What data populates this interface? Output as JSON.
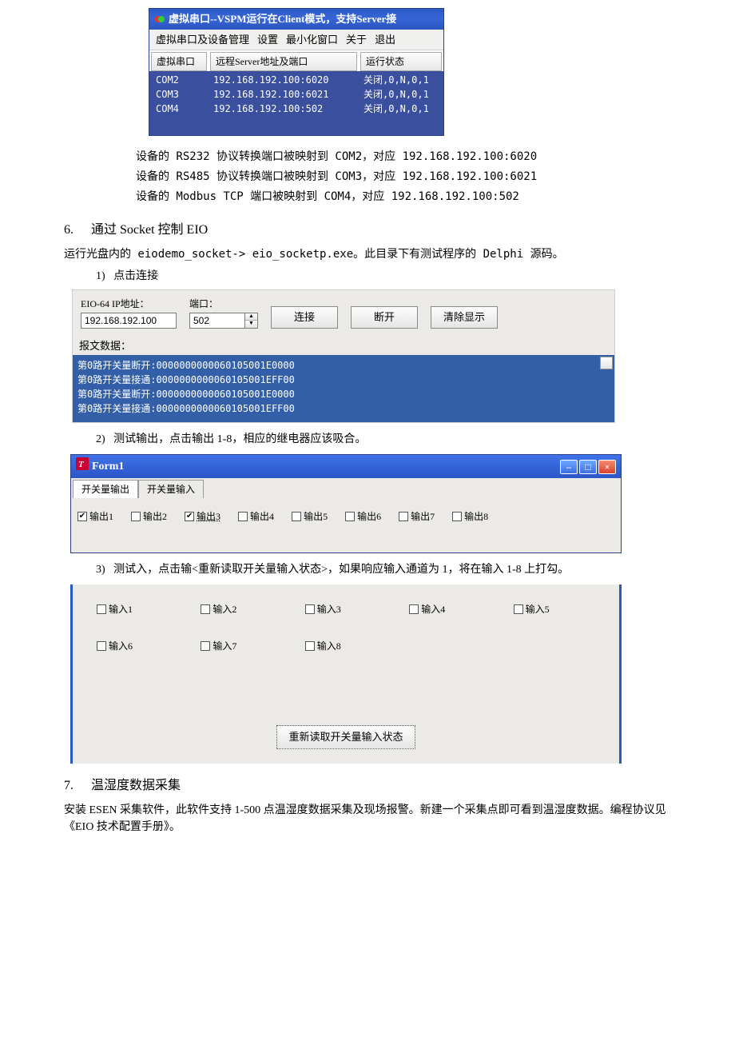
{
  "vspm": {
    "title": "虚拟串口--VSPM运行在Client模式，支持Server接",
    "menu": [
      "虚拟串口及设备管理",
      "设置",
      "最小化窗口",
      "关于",
      "退出"
    ],
    "headers": [
      "虚拟串口",
      "远程Server地址及端口",
      "运行状态"
    ],
    "rows": [
      {
        "port": "COM2",
        "addr": "192.168.192.100:6020",
        "state": "关闭,0,N,0,1"
      },
      {
        "port": "COM3",
        "addr": "192.168.192.100:6021",
        "state": "关闭,0,N,0,1"
      },
      {
        "port": "COM4",
        "addr": "192.168.192.100:502",
        "state": "关闭,0,N,0,1"
      }
    ]
  },
  "mapping": [
    "设备的 RS232 协议转换端口被映射到 COM2，对应 192.168.192.100:6020",
    "设备的 RS485 协议转换端口被映射到 COM3，对应 192.168.192.100:6021",
    "设备的 Modbus TCP 端口被映射到 COM4，对应 192.168.192.100:502"
  ],
  "section6": {
    "heading_num": "6.",
    "heading": "通过 Socket 控制 EIO",
    "intro": "运行光盘内的 eiodemo_socket-> eio_socketp.exe。此目录下有测试程序的 Delphi 源码。",
    "step1_num": "1)",
    "step1": "点击连接",
    "step2_num": "2)",
    "step2": "测试输出，点击输出 1-8，相应的继电器应该吸合。",
    "step3_num": "3)",
    "step3": "测试入，点击输<重新读取开关量输入状态>，如果响应输入通道为 1，将在输入 1-8 上打勾。"
  },
  "socket_tool": {
    "ip_label": "EIO-64 IP地址：",
    "ip_value": "192.168.192.100",
    "port_label": "端口：",
    "port_value": "502",
    "btn_connect": "连接",
    "btn_disconnect": "断开",
    "btn_clear": "清除显示",
    "log_label": "报文数据：",
    "log_lines": [
      "第0路开关量断开:0000000000060105001E0000",
      "第0路开关量接通:0000000000060105001EFF00",
      "第0路开关量断开:0000000000060105001E0000",
      "第0路开关量接通:0000000000060105001EFF00"
    ]
  },
  "form1": {
    "title": "Form1",
    "tab_out": "开关量输出",
    "tab_in": "开关量输入",
    "outputs": [
      {
        "label": "输出1",
        "checked": true,
        "underline": false
      },
      {
        "label": "输出2",
        "checked": false,
        "underline": false
      },
      {
        "label": "输出3",
        "checked": true,
        "underline": true
      },
      {
        "label": "输出4",
        "checked": false,
        "underline": false
      },
      {
        "label": "输出5",
        "checked": false,
        "underline": false
      },
      {
        "label": "输出6",
        "checked": false,
        "underline": false
      },
      {
        "label": "输出7",
        "checked": false,
        "underline": false
      },
      {
        "label": "输出8",
        "checked": false,
        "underline": false
      }
    ]
  },
  "inputs_panel": {
    "inputs": [
      {
        "label": "输入1"
      },
      {
        "label": "输入2"
      },
      {
        "label": "输入3"
      },
      {
        "label": "输入4"
      },
      {
        "label": "输入5"
      },
      {
        "label": "输入6"
      },
      {
        "label": "输入7"
      },
      {
        "label": "输入8"
      }
    ],
    "refresh_btn": "重新读取开关量输入状态"
  },
  "section7": {
    "heading_num": "7.",
    "heading": "温湿度数据采集",
    "body": "安装 ESEN 采集软件，此软件支持 1-500 点温湿度数据采集及现场报警。新建一个采集点即可看到温湿度数据。编程协议见《EIO 技术配置手册》。"
  }
}
